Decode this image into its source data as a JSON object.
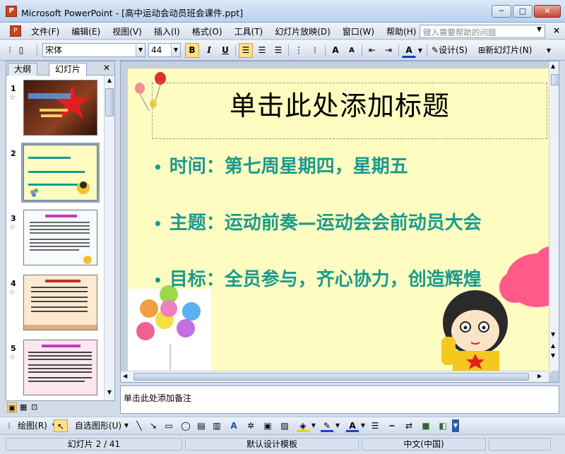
{
  "window": {
    "title": "Microsoft PowerPoint - [高中运动会动员班会课件.ppt]",
    "min": "─",
    "max": "□",
    "close": "✕"
  },
  "menu": {
    "items": [
      "文件(F)",
      "编辑(E)",
      "视图(V)",
      "插入(I)",
      "格式(O)",
      "工具(T)",
      "幻灯片放映(D)",
      "窗口(W)",
      "帮助(H)"
    ],
    "help_placeholder": "键入需要帮助的问题"
  },
  "toolbar": {
    "font": "宋体",
    "size": "44",
    "bold": "B",
    "italic": "I",
    "underline": "U",
    "design": "设计(S)",
    "new_slide": "新幻灯片(N)"
  },
  "leftpane": {
    "tab_outline": "大纲",
    "tab_slides": "幻灯片",
    "slides": [
      "1",
      "2",
      "3",
      "4",
      "5"
    ]
  },
  "slide": {
    "title": "单击此处添加标题",
    "bullets": [
      "时间：第七周星期四，星期五",
      "主题：运动前奏—运动会会前动员大会",
      "目标：全员参与，齐心协力，创造辉煌"
    ]
  },
  "notes": {
    "placeholder": "单击此处添加备注"
  },
  "drawbar": {
    "draw": "绘图(R)",
    "autoshapes": "自选图形(U)"
  },
  "status": {
    "slide": "幻灯片 2 / 41",
    "template": "默认设计模板",
    "language": "中文(中国)"
  },
  "colors": {
    "slide_bg": "#fefcc0",
    "bullet": "#1b9a8e",
    "accent": "#ffe08a"
  }
}
